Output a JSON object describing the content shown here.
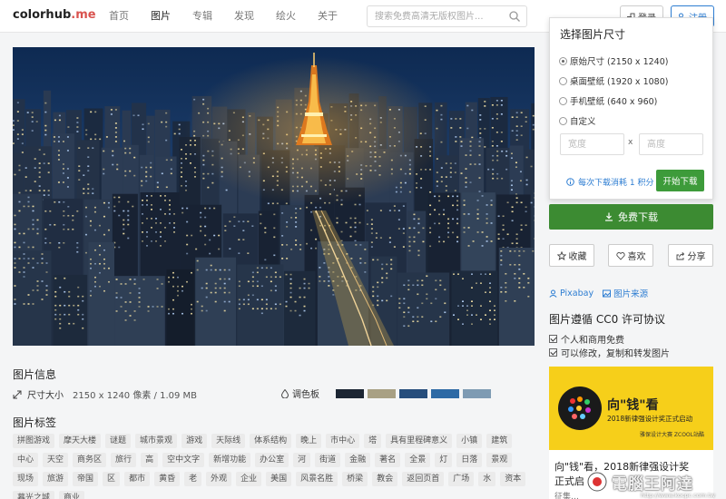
{
  "header": {
    "logo_main": "colorhub",
    "logo_dot": ".",
    "logo_tld": "me",
    "nav": [
      "首页",
      "图片",
      "专辑",
      "发现",
      "绘火",
      "关于"
    ],
    "search_placeholder": "搜索免费高清无版权图片...",
    "login_label": "登录",
    "register_label": "注册"
  },
  "size_popup": {
    "title": "选择图片尺寸",
    "options": [
      {
        "label": "原始尺寸 (2150 x 1240)",
        "checked": true
      },
      {
        "label": "桌面壁纸 (1920 x 1080)",
        "checked": false
      },
      {
        "label": "手机壁纸 (640 x 960)",
        "checked": false
      },
      {
        "label": "自定义",
        "checked": false
      }
    ],
    "width_placeholder": "宽度",
    "separator": "x",
    "height_placeholder": "高度",
    "consume_note": "每次下载消耗 1 积分",
    "start_label": "开始下载"
  },
  "actions": {
    "free_download": "免费下载",
    "collect": "收藏",
    "like": "喜欢",
    "share": "分享",
    "author_link": "Pixabay",
    "source_link": "图片来源"
  },
  "license": {
    "title": "图片遵循 CC0 许可协议",
    "items": [
      "个人和商用免费",
      "可以修改，复制和转发图片"
    ]
  },
  "image_info": {
    "title": "图片信息",
    "size_label": "尺寸大小",
    "size_value": "2150 x 1240 像素 / 1.09 MB",
    "palette_label": "调色板",
    "palette": [
      "#1c2634",
      "#a8a084",
      "#274e7c",
      "#2e6aa5",
      "#7e9bb3"
    ]
  },
  "tags": {
    "title": "图片标签",
    "items": [
      "拼图游戏",
      "摩天大楼",
      "谜题",
      "城市景观",
      "游戏",
      "天际线",
      "体系结构",
      "晚上",
      "市中心",
      "塔",
      "具有里程碑意义",
      "小镇",
      "建筑",
      "中心",
      "天空",
      "商务区",
      "旅行",
      "高",
      "空中文字",
      "新增功能",
      "办公室",
      "河",
      "街道",
      "金融",
      "著名",
      "全景",
      "灯",
      "日落",
      "景观",
      "现场",
      "旅游",
      "帝国",
      "区",
      "都市",
      "黄昏",
      "老",
      "外观",
      "企业",
      "美国",
      "风景名胜",
      "桥梁",
      "教会",
      "返回页首",
      "广场",
      "水",
      "资本",
      "暮光之城",
      "商业"
    ]
  },
  "ad": {
    "slogan": "向\"钱\"看",
    "sub": "2018新律强设计奖正式启动",
    "small": "雅保设计大赛  ZCOOL站酷",
    "text1": "向\"钱\"看，2018新律强设计奖",
    "text2": "正式启",
    "text3": "征集…"
  },
  "watermark": {
    "text": "電腦王阿達",
    "url": "http://www.kocpc.com.tw"
  }
}
